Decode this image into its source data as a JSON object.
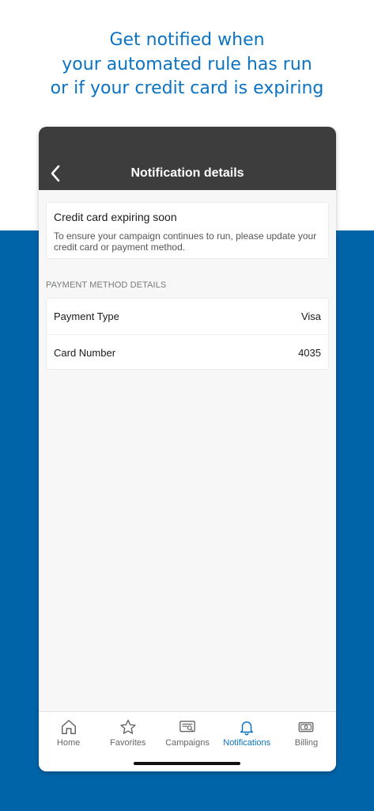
{
  "headline": {
    "line1": "Get notified when",
    "line2": "your automated rule has run",
    "line3": "or if your credit card is expiring"
  },
  "navbar": {
    "title": "Notification details",
    "back_icon": "chevron-left-icon"
  },
  "notification": {
    "title": "Credit card expiring soon",
    "body": "To ensure your campaign continues to run, please update your credit card or payment method."
  },
  "payment_section": {
    "label": "PAYMENT METHOD DETAILS",
    "rows": [
      {
        "label": "Payment Type",
        "value": "Visa"
      },
      {
        "label": "Card Number",
        "value": "4035"
      }
    ]
  },
  "tabs": [
    {
      "label": "Home",
      "icon": "home-icon",
      "active": false
    },
    {
      "label": "Favorites",
      "icon": "star-icon",
      "active": false
    },
    {
      "label": "Campaigns",
      "icon": "campaigns-icon",
      "active": false
    },
    {
      "label": "Notifications",
      "icon": "bell-icon",
      "active": true
    },
    {
      "label": "Billing",
      "icon": "billing-icon",
      "active": false
    }
  ],
  "colors": {
    "accent": "#0b73c2",
    "background_band": "#0064a8",
    "navbar": "#3d3d3d"
  }
}
